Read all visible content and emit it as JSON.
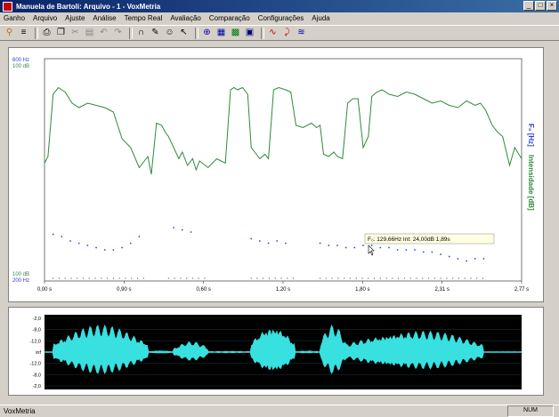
{
  "window": {
    "title": "Manuela de Bartoli: Arquivo - 1 - VoxMetria"
  },
  "menu": [
    "Ganho",
    "Arquivo",
    "Ajuste",
    "Análise",
    "Tempo Real",
    "Avaliação",
    "Comparação",
    "Configurações",
    "Ajuda"
  ],
  "toolbar_icons": [
    "open-icon",
    "list-icon",
    "print-icon",
    "copy-icon",
    "cut-icon",
    "paste-icon",
    "undo-icon",
    "redo-icon",
    "pitch-icon",
    "pencil-icon",
    "person-icon",
    "cursor-icon",
    "zoom-icon",
    "graph-icon",
    "table-icon",
    "image-icon",
    "chart-icon",
    "curve-icon",
    "wave-icon",
    "settings-icon"
  ],
  "chart": {
    "left_axis_top": [
      "600 Hz",
      "100 dB"
    ],
    "left_axis_bottom": [
      "100 dB",
      "200 Hz"
    ],
    "x_ticks": [
      "0,00 s",
      "0,90 s",
      "0,60 s",
      "1,20 s",
      "1,80 s",
      "2,31 s",
      "2,77 s"
    ],
    "right_label_f0": "F₀ [Hz]",
    "right_label_intensity": "Intensidade [dB]",
    "tooltip": "F₀: 129,66Hz  Int: 24,00dB  1,89s"
  },
  "waveform": {
    "y_ticks": [
      "-2,0",
      "-8,0",
      "-12,0",
      "inf",
      "-12,0",
      "-8,0",
      "-2,0"
    ]
  },
  "chart_data": {
    "type": "line",
    "title": "",
    "xlabel": "",
    "ylabel": "",
    "xlim": [
      0,
      2.77
    ],
    "series": [
      {
        "name": "Intensidade [dB]",
        "color": "#2e8b3a",
        "x": [
          0.0,
          0.02,
          0.05,
          0.08,
          0.12,
          0.16,
          0.2,
          0.25,
          0.3,
          0.35,
          0.4,
          0.45,
          0.5,
          0.55,
          0.6,
          0.62,
          0.65,
          0.68,
          0.7,
          0.72,
          0.75,
          0.78,
          0.8,
          0.83,
          0.86,
          0.88,
          0.9,
          0.95,
          1.0,
          1.05,
          1.08,
          1.1,
          1.12,
          1.15,
          1.18,
          1.2,
          1.22,
          1.25,
          1.28,
          1.3,
          1.33,
          1.36,
          1.4,
          1.43,
          1.46,
          1.5,
          1.55,
          1.58,
          1.6,
          1.62,
          1.65,
          1.68,
          1.7,
          1.73,
          1.76,
          1.79,
          1.82,
          1.85,
          1.88,
          1.9,
          1.93,
          1.96,
          2.0,
          2.05,
          2.1,
          2.15,
          2.2,
          2.25,
          2.3,
          2.35,
          2.4,
          2.45,
          2.5,
          2.53,
          2.56,
          2.6,
          2.63,
          2.66,
          2.7,
          2.73,
          2.77
        ],
        "values": [
          0.53,
          0.56,
          0.84,
          0.87,
          0.85,
          0.8,
          0.78,
          0.8,
          0.79,
          0.78,
          0.76,
          0.64,
          0.6,
          0.51,
          0.56,
          0.48,
          0.71,
          0.7,
          0.67,
          0.65,
          0.6,
          0.55,
          0.58,
          0.52,
          0.55,
          0.5,
          0.54,
          0.51,
          0.55,
          0.53,
          0.86,
          0.87,
          0.86,
          0.87,
          0.84,
          0.6,
          0.58,
          0.55,
          0.57,
          0.55,
          0.86,
          0.87,
          0.86,
          0.85,
          0.7,
          0.69,
          0.71,
          0.69,
          0.7,
          0.57,
          0.56,
          0.58,
          0.56,
          0.55,
          0.8,
          0.82,
          0.82,
          0.6,
          0.65,
          0.83,
          0.85,
          0.86,
          0.84,
          0.83,
          0.85,
          0.84,
          0.82,
          0.8,
          0.81,
          0.79,
          0.78,
          0.81,
          0.79,
          0.8,
          0.77,
          0.7,
          0.67,
          0.65,
          0.52,
          0.6,
          0.55
        ]
      },
      {
        "name": "F₀ [Hz]",
        "color": "#2f3fd6",
        "x": [
          0.05,
          0.1,
          0.15,
          0.2,
          0.25,
          0.3,
          0.35,
          0.4,
          0.45,
          0.5,
          0.55,
          0.75,
          0.8,
          0.85,
          1.2,
          1.25,
          1.3,
          1.35,
          1.4,
          1.6,
          1.65,
          1.7,
          1.75,
          1.8,
          1.85,
          1.9,
          1.95,
          2.0,
          2.05,
          2.1,
          2.15,
          2.2,
          2.25,
          2.3,
          2.35,
          2.4,
          2.45,
          2.5,
          2.55
        ],
        "values": [
          0.21,
          0.2,
          0.18,
          0.17,
          0.16,
          0.15,
          0.14,
          0.14,
          0.15,
          0.17,
          0.2,
          0.24,
          0.23,
          0.22,
          0.19,
          0.18,
          0.17,
          0.18,
          0.17,
          0.17,
          0.16,
          0.16,
          0.15,
          0.15,
          0.16,
          0.16,
          0.15,
          0.15,
          0.14,
          0.14,
          0.14,
          0.13,
          0.13,
          0.12,
          0.11,
          0.1,
          0.09,
          0.1,
          0.1
        ]
      }
    ]
  }
}
